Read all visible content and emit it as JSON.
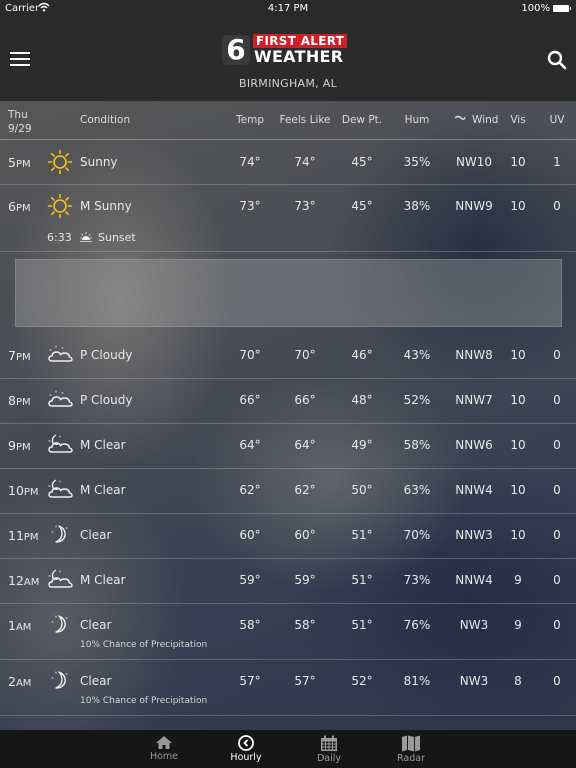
{
  "status_bar": {
    "carrier": "Carrier",
    "time": "4:17 PM",
    "battery": "100%"
  },
  "header": {
    "logo_number": "6",
    "logo_top": "FIRST ALERT",
    "logo_bottom": "WEATHER",
    "location": "BIRMINGHAM, AL"
  },
  "columns": {
    "day": "Thu",
    "date": "9/29",
    "condition": "Condition",
    "temp": "Temp",
    "feels_like": "Feels Like",
    "dew_pt": "Dew Pt.",
    "hum": "Hum",
    "wind": "Wind",
    "vis": "Vis",
    "uv": "UV"
  },
  "rows": [
    {
      "hour": "5",
      "ampm": "PM",
      "icon": "sun-icon",
      "condition": "Sunny",
      "temp": "74°",
      "feels": "74°",
      "dew": "45°",
      "hum": "35%",
      "wind": "NW10",
      "vis": "10",
      "uv": "1"
    },
    {
      "hour": "6",
      "ampm": "PM",
      "icon": "sun-icon",
      "condition": "M Sunny",
      "temp": "73°",
      "feels": "73°",
      "dew": "45°",
      "hum": "38%",
      "wind": "NNW9",
      "vis": "10",
      "uv": "0"
    },
    {
      "hour": "7",
      "ampm": "PM",
      "icon": "partly-cloudy-icon",
      "condition": "P Cloudy",
      "temp": "70°",
      "feels": "70°",
      "dew": "46°",
      "hum": "43%",
      "wind": "NNW8",
      "vis": "10",
      "uv": "0"
    },
    {
      "hour": "8",
      "ampm": "PM",
      "icon": "partly-cloudy-icon",
      "condition": "P Cloudy",
      "temp": "66°",
      "feels": "66°",
      "dew": "48°",
      "hum": "52%",
      "wind": "NNW7",
      "vis": "10",
      "uv": "0"
    },
    {
      "hour": "9",
      "ampm": "PM",
      "icon": "moon-cloud-icon",
      "condition": "M Clear",
      "temp": "64°",
      "feels": "64°",
      "dew": "49°",
      "hum": "58%",
      "wind": "NNW6",
      "vis": "10",
      "uv": "0"
    },
    {
      "hour": "10",
      "ampm": "PM",
      "icon": "moon-cloud-icon",
      "condition": "M Clear",
      "temp": "62°",
      "feels": "62°",
      "dew": "50°",
      "hum": "63%",
      "wind": "NNW4",
      "vis": "10",
      "uv": "0"
    },
    {
      "hour": "11",
      "ampm": "PM",
      "icon": "moon-icon",
      "condition": "Clear",
      "temp": "60°",
      "feels": "60°",
      "dew": "51°",
      "hum": "70%",
      "wind": "NNW3",
      "vis": "10",
      "uv": "0"
    },
    {
      "hour": "12",
      "ampm": "AM",
      "icon": "moon-cloud-icon",
      "condition": "M Clear",
      "temp": "59°",
      "feels": "59°",
      "dew": "51°",
      "hum": "73%",
      "wind": "NNW4",
      "vis": "9",
      "uv": "0"
    },
    {
      "hour": "1",
      "ampm": "AM",
      "icon": "moon-icon",
      "condition": "Clear",
      "temp": "58°",
      "feels": "58°",
      "dew": "51°",
      "hum": "76%",
      "wind": "NW3",
      "vis": "9",
      "uv": "0",
      "precip": "10% Chance of Precipitation"
    },
    {
      "hour": "2",
      "ampm": "AM",
      "icon": "moon-icon",
      "condition": "Clear",
      "temp": "57°",
      "feels": "57°",
      "dew": "52°",
      "hum": "81%",
      "wind": "NW3",
      "vis": "8",
      "uv": "0",
      "precip": "10% Chance of Precipitation"
    }
  ],
  "sunset": {
    "time": "6:33",
    "label": "Sunset"
  },
  "tabs": [
    {
      "label": "Home",
      "icon": "home-icon"
    },
    {
      "label": "Hourly",
      "icon": "clock-icon",
      "active": true
    },
    {
      "label": "Daily",
      "icon": "calendar-icon"
    },
    {
      "label": "Radar",
      "icon": "map-icon"
    }
  ],
  "colors": {
    "accent_red": "#d21f26",
    "sun_yellow": "#f2c319",
    "tabbar": "#161616",
    "header": "#2b2b2b"
  }
}
